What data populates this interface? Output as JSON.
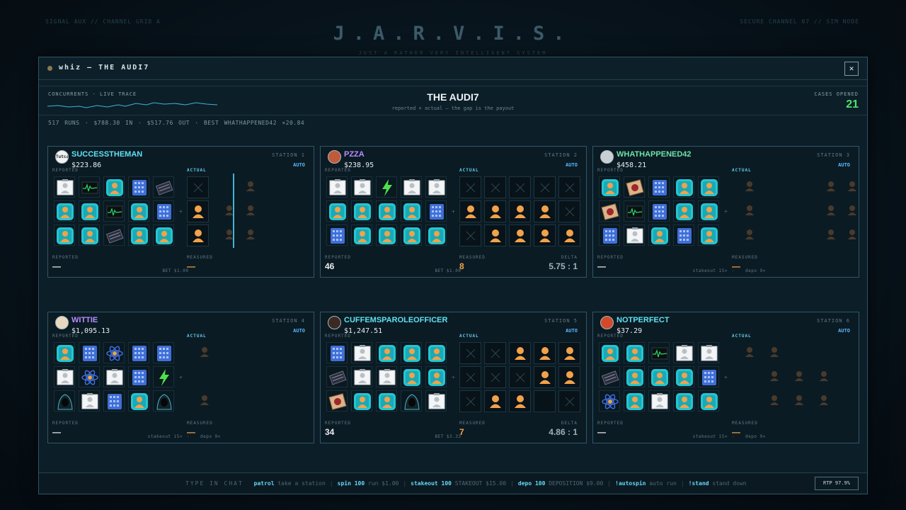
{
  "bg_left": "SIGNAL AUX // CHANNEL GRID A",
  "bg_right": "SECURE CHANNEL 07 // SIM NODE",
  "brand": "J.A.R.V.I.S.",
  "brand_sub": "JUST A RATHER VERY INTELLIGENT SYSTEM",
  "window_title": "whiz — THE AUDI7",
  "close_label": "✕",
  "header": {
    "concurrents_label": "CONCURRENTS · LIVE TRACE",
    "title": "THE AUDI7",
    "subtitle": "reported + actual — the gap is the payout",
    "cases_label": "CASES OPENED",
    "cases_value": "21"
  },
  "stats_line": "517 RUNS   ·   $788.30 IN   ·   $517.76 OUT   ·   BEST WHATHAPPENED42 ×20.84",
  "colors": {
    "accent": "#3fb5d6",
    "green": "#4fe26b",
    "orange": "#f2a24a",
    "name_cyan": "#5fe2f2",
    "name_purple": "#b98cff",
    "name_green": "#6fe2a6"
  },
  "cards": [
    {
      "name": "SUCCESSTHEMAN",
      "name_color": "#5fe2f2",
      "station": "STATION 1",
      "balance": "$223.86",
      "mode": "AUTO",
      "reported_label": "REPORTED",
      "actual_label": "ACTUAL",
      "rep_label": "REPORTED",
      "rep_value": "—",
      "meas_label": "MEASURED",
      "meas_value": "—",
      "delta_label": "",
      "delta_value": "",
      "footer": "BET $1.00",
      "footer2": "",
      "avatar_text": "Tutcam",
      "grid": [
        [
          "person",
          "chart",
          "face",
          "server",
          "case"
        ],
        [
          "face",
          "face",
          "chart",
          "face",
          "server"
        ],
        [
          "face",
          "face",
          "case",
          "face",
          "face"
        ]
      ],
      "actual": [
        [
          "x",
          "ghost"
        ],
        [
          "orange",
          "ghost",
          "ghost"
        ],
        [
          "orange",
          "ghost",
          "ghost"
        ]
      ],
      "mode_type": "partial"
    },
    {
      "name": "PZZA",
      "name_color": "#b98cff",
      "station": "STATION 2",
      "balance": "$238.95",
      "mode": "AUTO",
      "reported_label": "REPORTED",
      "actual_label": "ACTUAL",
      "rep_label": "REPORTED",
      "rep_value": "46",
      "meas_label": "MEASURED",
      "meas_value": "8",
      "delta_label": "DELTA",
      "delta_value": "5.75 : 1",
      "footer": "BET $1.00",
      "footer2": "",
      "avatar_text": "",
      "grid": [
        [
          "person",
          "person",
          "bolt",
          "person",
          "person"
        ],
        [
          "face",
          "face",
          "face",
          "face",
          "server"
        ],
        [
          "server",
          "face",
          "face",
          "face",
          "face"
        ]
      ],
      "actual": [
        [
          "x",
          "x",
          "x",
          "x",
          "x"
        ],
        [
          "orange",
          "orange",
          "orange",
          "orange",
          "x"
        ],
        [
          "x",
          "orange",
          "orange",
          "orange",
          "orange"
        ]
      ],
      "mode_type": "full"
    },
    {
      "name": "WHATHAPPENED42",
      "name_color": "#6fe2a6",
      "station": "STATION 3",
      "balance": "$458.21",
      "mode": "AUTO",
      "reported_label": "REPORTED",
      "actual_label": "ACTUAL",
      "rep_label": "REPORTED",
      "rep_value": "—",
      "meas_label": "MEASURED",
      "meas_value": "—",
      "delta_label": "",
      "delta_value": "",
      "footer": "stakeout 15×",
      "footer2": "depo 9×",
      "avatar_text": "",
      "grid": [
        [
          "face",
          "scroll",
          "server",
          "face",
          "face"
        ],
        [
          "scroll",
          "chart",
          "server",
          "face",
          "face"
        ],
        [
          "server",
          "person",
          "face",
          "server",
          "face"
        ]
      ],
      "actual": [
        [
          "ghost",
          "ghost",
          "ghost"
        ],
        [
          "ghost",
          "ghost",
          "ghost"
        ],
        [
          "ghost",
          "ghost",
          "ghost"
        ]
      ],
      "mode_type": "ghost"
    },
    {
      "name": "WITTIE",
      "name_color": "#b98cff",
      "station": "STATION 4",
      "balance": "$1,095.13",
      "mode": "AUTO",
      "reported_label": "REPORTED",
      "actual_label": "ACTUAL",
      "rep_label": "REPORTED",
      "rep_value": "—",
      "meas_label": "MEASURED",
      "meas_value": "—",
      "delta_label": "",
      "delta_value": "",
      "footer": "stakeout 15×",
      "footer2": "depo 9×",
      "avatar_text": "",
      "grid": [
        [
          "face",
          "server",
          "atom",
          "server",
          "server"
        ],
        [
          "person",
          "atom",
          "person",
          "server",
          "bolt"
        ],
        [
          "hood",
          "person",
          "server",
          "face",
          "hood"
        ]
      ],
      "actual": [
        [
          "ghost"
        ],
        [],
        [
          "ghost"
        ]
      ],
      "mode_type": "ghost"
    },
    {
      "name": "CUFFEMSPAROLEOFFICER",
      "name_color": "#5fe2f2",
      "station": "STATION 5",
      "balance": "$1,247.51",
      "mode": "AUTO",
      "reported_label": "REPORTED",
      "actual_label": "ACTUAL",
      "rep_label": "REPORTED",
      "rep_value": "34",
      "meas_label": "MEASURED",
      "meas_value": "7",
      "delta_label": "DELTA",
      "delta_value": "4.86 : 1",
      "footer": "BET $3.33",
      "footer2": "",
      "avatar_text": "",
      "grid": [
        [
          "server",
          "person",
          "face",
          "face",
          "face"
        ],
        [
          "case",
          "person",
          "person",
          "face",
          "face"
        ],
        [
          "scroll",
          "face",
          "face",
          "hood",
          "person"
        ]
      ],
      "actual": [
        [
          "x",
          "x",
          "orange",
          "orange",
          "orange"
        ],
        [
          "x",
          "x",
          "x",
          "orange",
          "orange"
        ],
        [
          "x",
          "orange",
          "orange",
          "empty",
          "x"
        ]
      ],
      "mode_type": "full"
    },
    {
      "name": "NOTPERFECT",
      "name_color": "#5fe2f2",
      "station": "STATION 6",
      "balance": "$37.29",
      "mode": "AUTO",
      "reported_label": "REPORTED",
      "actual_label": "ACTUAL",
      "rep_label": "REPORTED",
      "rep_value": "—",
      "meas_label": "MEASURED",
      "meas_value": "—",
      "delta_label": "",
      "delta_value": "",
      "footer": "stakeout 15×",
      "footer2": "depo 9×",
      "avatar_text": "",
      "grid": [
        [
          "face",
          "face",
          "chart",
          "person",
          "person"
        ],
        [
          "case",
          "face",
          "face",
          "face",
          "server"
        ],
        [
          "atom",
          "face",
          "person",
          "face",
          "face"
        ]
      ],
      "actual": [
        [
          "ghost",
          "ghost"
        ],
        [
          "ghost",
          "ghost",
          "ghost"
        ],
        [
          "ghost",
          "ghost",
          "ghost"
        ]
      ],
      "mode_type": "ghost"
    }
  ],
  "bottom": {
    "chat_label": "TYPE IN CHAT",
    "commands": [
      {
        "cmd": "patrol",
        "desc": "take a station"
      },
      {
        "cmd": "spin 100",
        "desc": "run $1.00"
      },
      {
        "cmd": "stakeout 100",
        "desc": "STAKEOUT $15.00"
      },
      {
        "cmd": "depo 100",
        "desc": "DEPOSITION $9.00"
      },
      {
        "cmd": "!autospin",
        "desc": "auto run"
      },
      {
        "cmd": "!stand",
        "desc": "stand down"
      }
    ],
    "rtp": "RTP 97.9%"
  }
}
